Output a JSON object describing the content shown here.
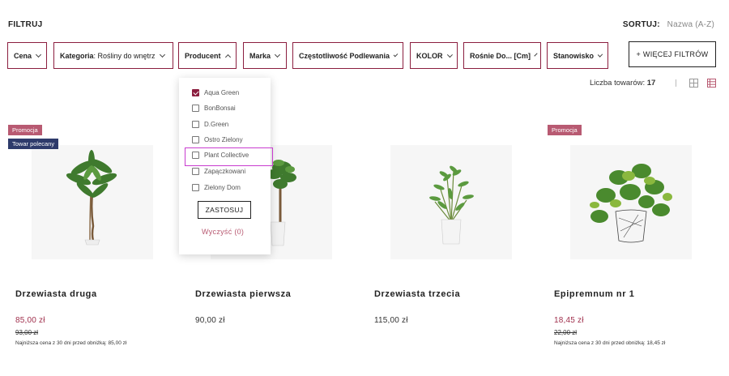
{
  "header": {
    "filter_title": "FILTRUJ",
    "sort_label": "SORTUJ:",
    "sort_value": "Nazwa (A-Z)"
  },
  "filters": [
    {
      "label": "Cena",
      "value": ""
    },
    {
      "label": "Kategoria",
      "value": ": Rośliny do wnętrz"
    },
    {
      "label": "Producent",
      "value": ""
    },
    {
      "label": "Marka",
      "value": ""
    },
    {
      "label": "Częstotliwość Podlewania",
      "value": ""
    },
    {
      "label": "KOLOR",
      "value": ""
    },
    {
      "label": "Rośnie Do... [Cm]",
      "value": ""
    },
    {
      "label": "Stanowisko",
      "value": ""
    }
  ],
  "more_filters_label": "+ WIĘCEJ FILTRÓW",
  "toolbar": {
    "count_label": "Liczba towarów:",
    "count_value": "17"
  },
  "dropdown": {
    "options": [
      {
        "label": "Aqua Green",
        "checked": true
      },
      {
        "label": "BonBonsai",
        "checked": false
      },
      {
        "label": "D.Green",
        "checked": false
      },
      {
        "label": "Ostro Zielony",
        "checked": false
      },
      {
        "label": "Plant Collective",
        "checked": false
      },
      {
        "label": "Zapączkowani",
        "checked": false
      },
      {
        "label": "Zielony Dom",
        "checked": false
      }
    ],
    "apply_label": "ZASTOSUJ",
    "clear_label": "Wyczyść (0)"
  },
  "products": [
    {
      "name": "Drzewiasta druga",
      "price": "85,00 zł",
      "old_price": "93,00 zł",
      "note": "Najniższa cena z 30 dni przed obniżką: 85,00 zł",
      "badges": [
        "Promocja",
        "Towar polecany"
      ]
    },
    {
      "name": "Drzewiasta pierwsza",
      "price": "90,00 zł",
      "old_price": "",
      "note": "",
      "badges": []
    },
    {
      "name": "Drzewiasta trzecia",
      "price": "115,00 zł",
      "old_price": "",
      "note": "",
      "badges": []
    },
    {
      "name": "Epipremnum nr 1",
      "price": "18,45 zł",
      "old_price": "22,00 zł",
      "note": "Najniższa cena z 30 dni przed obniżką: 18,45 zł",
      "badges": [
        "Promocja"
      ]
    }
  ],
  "colors": {
    "accent": "#8b1e3f",
    "promo_badge": "#b85a72",
    "recommended_badge": "#2e3b6b",
    "highlight": "#c83ccf"
  }
}
